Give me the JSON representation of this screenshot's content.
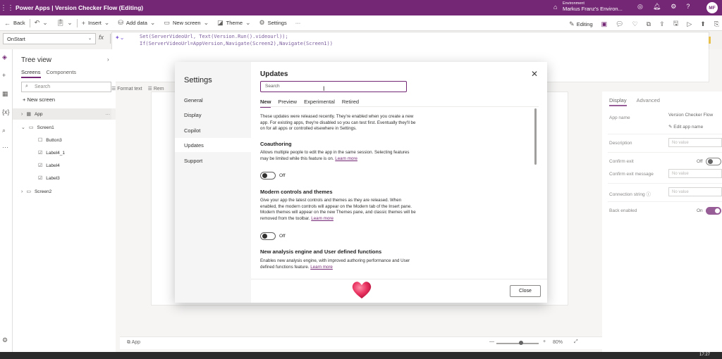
{
  "titlebar": {
    "app_name": "Power Apps",
    "separator": "|",
    "doc_title": "Version Checker Flow (Editing)",
    "environment_label": "Environment",
    "environment_name": "Markus Franz's Environ...",
    "avatar_initials": "MF"
  },
  "commandbar": {
    "back": "Back",
    "insert": "Insert",
    "add_data": "Add data",
    "new_screen": "New screen",
    "theme": "Theme",
    "settings": "Settings",
    "more": "···",
    "editing": "Editing"
  },
  "formula": {
    "property": "OnStart",
    "fx": "fx",
    "line1": "Set(ServerVideoUrl, Text(Version.Run().videourl));",
    "line2": "If(ServerVideoUrl=AppVersion,Navigate(Screen2),Navigate(Screen1))"
  },
  "format_strip": {
    "format_text": "Format text",
    "remove": "Rem"
  },
  "tree": {
    "title": "Tree view",
    "tab_screens": "Screens",
    "tab_components": "Components",
    "search_placeholder": "Search",
    "new_screen": "New screen",
    "nodes": [
      {
        "label": "App",
        "icon": "▦",
        "caret": "›"
      },
      {
        "label": "Screen1",
        "icon": "▭",
        "caret": "⌄"
      },
      {
        "label": "Button3",
        "icon": "☐",
        "caret": ""
      },
      {
        "label": "Label4_1",
        "icon": "☑",
        "caret": ""
      },
      {
        "label": "Label4",
        "icon": "☑",
        "caret": ""
      },
      {
        "label": "Label3",
        "icon": "☑",
        "caret": ""
      },
      {
        "label": "Screen2",
        "icon": "▭",
        "caret": "›"
      }
    ]
  },
  "bottombar": {
    "app": "App",
    "zoom": "80%"
  },
  "props": {
    "tab_display": "Display",
    "tab_advanced": "Advanced",
    "app_name_label": "App name",
    "app_name_value": "Version Checker Flow",
    "edit_app_name": "Edit app name",
    "description_label": "Description",
    "description_placeholder": "No value",
    "confirm_exit_label": "Confirm exit",
    "confirm_exit_state": "Off",
    "confirm_exit_message_label": "Confirm exit message",
    "confirm_exit_message_placeholder": "No value",
    "connection_string_label": "Connection string",
    "connection_string_placeholder": "No value",
    "back_enabled_label": "Back enabled",
    "back_enabled_state": "On"
  },
  "dialog": {
    "title": "Settings",
    "nav": [
      "General",
      "Display",
      "Copilot",
      "Updates",
      "Support"
    ],
    "active_nav": "Updates",
    "section_title": "Updates",
    "search_placeholder": "Search",
    "tabs": [
      "New",
      "Preview",
      "Experimental",
      "Retired"
    ],
    "intro": "These updates were released recently. They're enabled when you create a new app. For existing apps, they're disabled so you can test first. Eventually they'll be on for all apps or controlled elsewhere in Settings.",
    "features": [
      {
        "title": "Coauthoring",
        "desc": "Allows multiple people to edit the app in the same session. Selecting features may be limited while this feature is on.",
        "learn_more": "Learn more",
        "state": "Off"
      },
      {
        "title": "Modern controls and themes",
        "desc": "Give your app the latest controls and themes as they are released. When enabled, the modern controls will appear on the Modern tab of the Insert pane. Modern themes will appear on the new Themes pane, and classic themes will be removed from the toolbar.",
        "learn_more": "Learn more",
        "state": "Off"
      },
      {
        "title": "New analysis engine and User defined functions",
        "desc": "Enables new analysis engine, with improved authoring performance and User defined functions feature.",
        "learn_more": "Learn more"
      }
    ],
    "close_button": "Close"
  },
  "taskbar": {
    "time": "17:27"
  },
  "colors": {
    "brand": "#742774",
    "accent_heart": "#e8315f"
  }
}
